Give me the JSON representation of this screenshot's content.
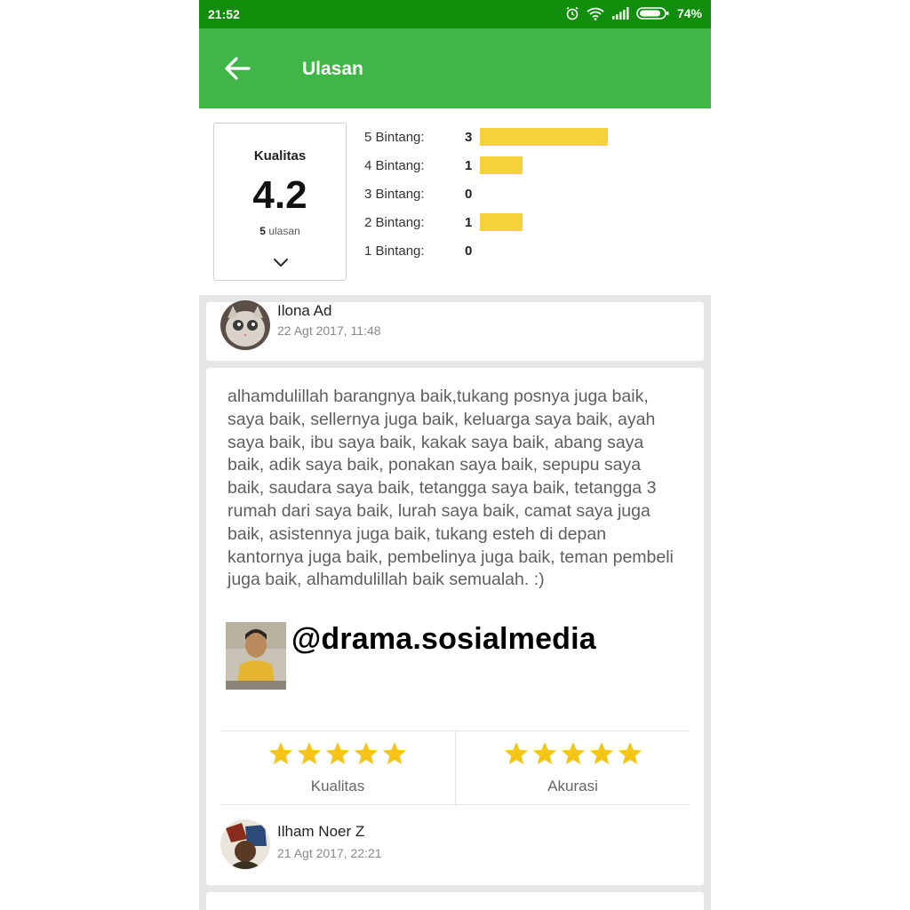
{
  "status_bar": {
    "time": "21:52",
    "battery": "74%"
  },
  "app_bar": {
    "title": "Ulasan"
  },
  "summary": {
    "label": "Kualitas",
    "score": "4.2",
    "review_count": "5",
    "review_unit": "ulasan",
    "max_count": 3,
    "rows": [
      {
        "label": "5 Bintang:",
        "count": "3",
        "value": 3
      },
      {
        "label": "4 Bintang:",
        "count": "1",
        "value": 1
      },
      {
        "label": "3 Bintang:",
        "count": "0",
        "value": 0
      },
      {
        "label": "2 Bintang:",
        "count": "1",
        "value": 1
      },
      {
        "label": "1 Bintang:",
        "count": "0",
        "value": 0
      }
    ],
    "bar_color": "#f7d33a"
  },
  "reviews": [
    {
      "name": "Ilona Ad",
      "date": "22 Agt 2017, 11:48"
    },
    {
      "name": "Ilham Noer Z",
      "date": "21 Agt 2017, 22:21"
    }
  ],
  "main_review": {
    "text": "alhamdulillah barangnya baik,tukang posnya juga baik, saya baik, sellernya juga baik, keluarga saya baik, ayah saya baik, ibu saya baik, kakak saya baik, abang saya baik, adik saya baik, ponakan saya baik, sepupu saya baik, saudara saya baik, tetangga saya baik, tetangga 3 rumah dari saya baik, lurah saya baik, camat saya juga baik, asistennya juga baik, tukang esteh di depan kantornya juga baik, pembelinya juga baik, teman pembeli juga baik, alhamdulillah baik semualah. :)",
    "watermark": "@drama.sosialmedia",
    "ratings": [
      {
        "label": "Kualitas",
        "stars": 5
      },
      {
        "label": "Akurasi",
        "stars": 5
      }
    ]
  },
  "colors": {
    "status_bar": "#0f8d0b",
    "app_bar": "#42b549",
    "star": "#f5c518"
  }
}
